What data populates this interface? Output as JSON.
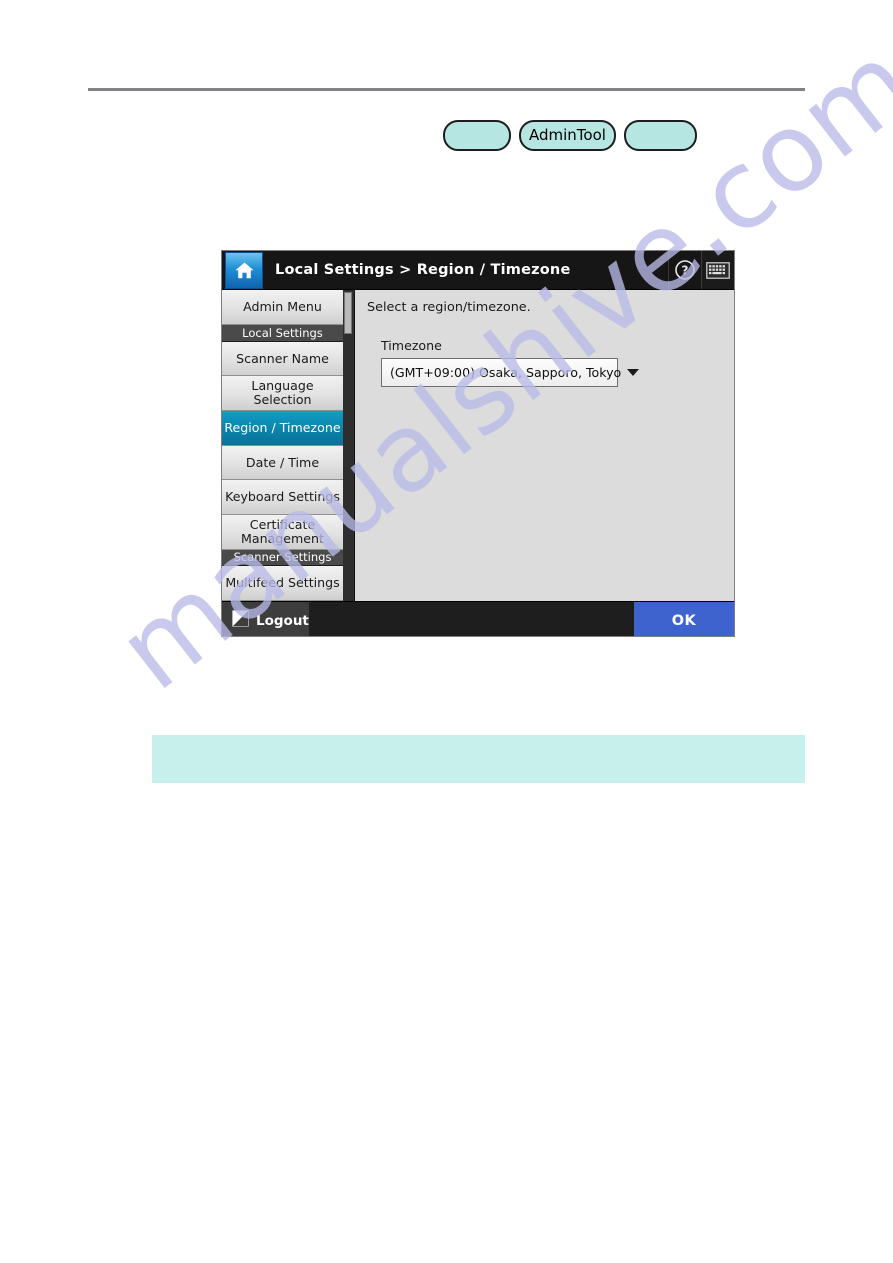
{
  "page": {
    "watermark": "manualshive.com"
  },
  "chips": [
    {
      "label": "",
      "name": "chip-blank-left"
    },
    {
      "label": "AdminTool",
      "name": "chip-admintool"
    },
    {
      "label": "",
      "name": "chip-blank-right"
    }
  ],
  "device": {
    "header": {
      "home_icon": "home-icon",
      "breadcrumb": "Local Settings > Region / Timezone",
      "help_icon": "help-icon",
      "keyboard_icon": "keyboard-icon"
    },
    "sidebar": {
      "items": [
        {
          "label": "Admin Menu",
          "type": "item",
          "selected": false
        },
        {
          "label": "Local Settings",
          "type": "section",
          "selected": false
        },
        {
          "label": "Scanner Name",
          "type": "item",
          "selected": false
        },
        {
          "label": "Language Selection",
          "type": "item",
          "selected": false
        },
        {
          "label": "Region / Timezone",
          "type": "item",
          "selected": true
        },
        {
          "label": "Date / Time",
          "type": "item",
          "selected": false
        },
        {
          "label": "Keyboard Settings",
          "type": "item",
          "selected": false
        },
        {
          "label": "Certificate Management",
          "type": "item",
          "selected": false
        },
        {
          "label": "Scanner Settings",
          "type": "section",
          "selected": false
        },
        {
          "label": "Multifeed Settings",
          "type": "item",
          "selected": false
        }
      ]
    },
    "content": {
      "instruction": "Select a region/timezone.",
      "field_label": "Timezone",
      "timezone_value": "(GMT+09:00) Osaka, Sapporo, Tokyo",
      "dropdown_icon": "chevron-down-icon"
    },
    "footer": {
      "logout_label": "Logout",
      "logout_icon": "logout-icon",
      "ok_label": "OK"
    }
  },
  "colors": {
    "accent_selected": "#0b83ab",
    "ok_button": "#3e63cf",
    "highlight_chip": "#b5e6e2",
    "note_band": "#c7f0ec",
    "header_bar": "#161616"
  }
}
